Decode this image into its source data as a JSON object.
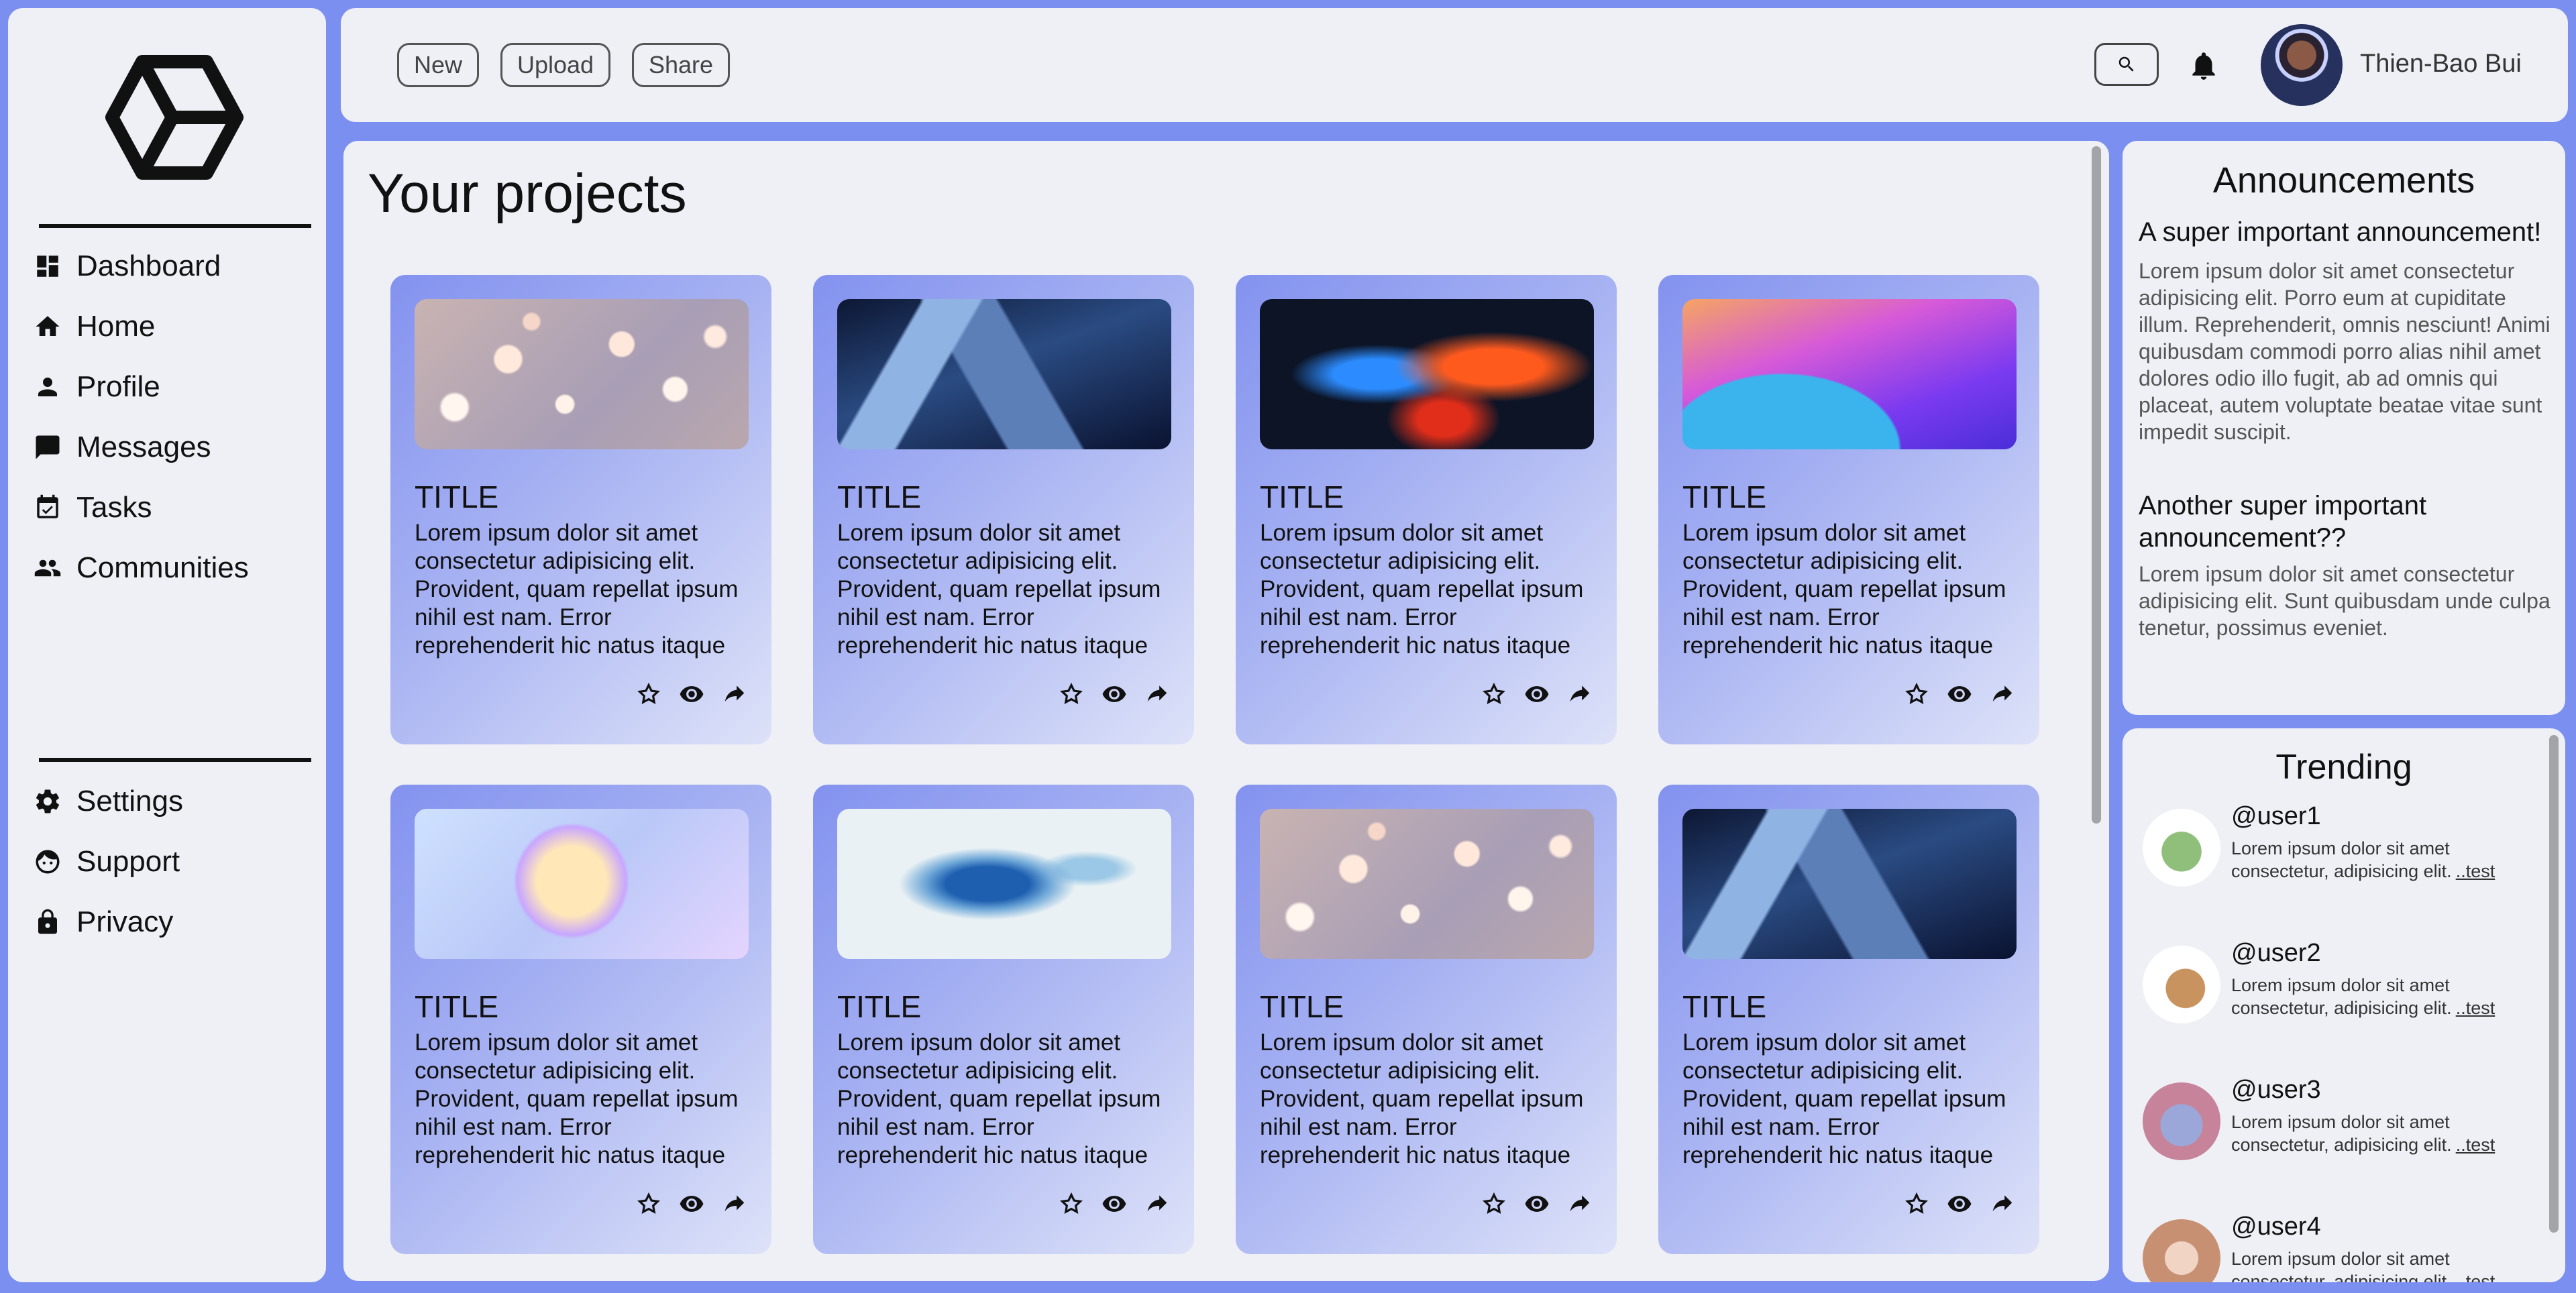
{
  "sidebar": {
    "nav_items": [
      {
        "label": "Dashboard",
        "icon": "dashboard-icon"
      },
      {
        "label": "Home",
        "icon": "home-icon"
      },
      {
        "label": "Profile",
        "icon": "person-icon"
      },
      {
        "label": "Messages",
        "icon": "message-icon"
      },
      {
        "label": "Tasks",
        "icon": "calendar-check-icon"
      },
      {
        "label": "Communities",
        "icon": "group-icon"
      }
    ],
    "bottom_items": [
      {
        "label": "Settings",
        "icon": "gear-icon"
      },
      {
        "label": "Support",
        "icon": "support-icon"
      },
      {
        "label": "Privacy",
        "icon": "lock-icon"
      }
    ]
  },
  "topbar": {
    "buttons": [
      "New",
      "Upload",
      "Share"
    ],
    "username": "Thien-Bao Bui"
  },
  "main": {
    "title": "Your projects",
    "cards": [
      {
        "title": "TITLE",
        "text": "Lorem ipsum dolor sit amet consectetur adipisicing elit. Provident, quam repellat ipsum nihil est nam. Error reprehenderit hic natus itaque",
        "image": "bokeh"
      },
      {
        "title": "TITLE",
        "text": "Lorem ipsum dolor sit amet consectetur adipisicing elit. Provident, quam repellat ipsum nihil est nam. Error reprehenderit hic natus itaque",
        "image": "glass"
      },
      {
        "title": "TITLE",
        "text": "Lorem ipsum dolor sit amet consectetur adipisicing elit. Provident, quam repellat ipsum nihil est nam. Error reprehenderit hic natus itaque",
        "image": "smoke"
      },
      {
        "title": "TITLE",
        "text": "Lorem ipsum dolor sit amet consectetur adipisicing elit. Provident, quam repellat ipsum nihil est nam. Error reprehenderit hic natus itaque",
        "image": "waves"
      },
      {
        "title": "TITLE",
        "text": "Lorem ipsum dolor sit amet consectetur adipisicing elit. Provident, quam repellat ipsum nihil est nam. Error reprehenderit hic natus itaque",
        "image": "sphere"
      },
      {
        "title": "TITLE",
        "text": "Lorem ipsum dolor sit amet consectetur adipisicing elit. Provident, quam repellat ipsum nihil est nam. Error reprehenderit hic natus itaque",
        "image": "ink"
      },
      {
        "title": "TITLE",
        "text": "Lorem ipsum dolor sit amet consectetur adipisicing elit. Provident, quam repellat ipsum nihil est nam. Error reprehenderit hic natus itaque",
        "image": "bokeh"
      },
      {
        "title": "TITLE",
        "text": "Lorem ipsum dolor sit amet consectetur adipisicing elit. Provident, quam repellat ipsum nihil est nam. Error reprehenderit hic natus itaque",
        "image": "glass"
      }
    ]
  },
  "announcements": {
    "title": "Announcements",
    "items": [
      {
        "heading": "A super important announcement!",
        "body": "Lorem ipsum dolor sit amet consectetur adipisicing elit. Porro eum at cupiditate illum. Reprehenderit, omnis nesciunt! Animi quibusdam commodi porro alias nihil amet dolores odio illo fugit, ab ad omnis qui placeat, autem voluptate beatae vitae sunt impedit suscipit."
      },
      {
        "heading": "Another super important announcement??",
        "body": "Lorem ipsum dolor sit amet consectetur adipisicing elit. Sunt quibusdam unde culpa tenetur, possimus eveniet."
      }
    ]
  },
  "trending": {
    "title": "Trending",
    "users": [
      {
        "handle": "@user1",
        "text": "Lorem ipsum dolor sit amet consectetur, adipisicing elit.",
        "link": "..test"
      },
      {
        "handle": "@user2",
        "text": "Lorem ipsum dolor sit amet consectetur, adipisicing elit.",
        "link": "..test"
      },
      {
        "handle": "@user3",
        "text": "Lorem ipsum dolor sit amet consectetur, adipisicing elit.",
        "link": "..test"
      },
      {
        "handle": "@user4",
        "text": "Lorem ipsum dolor sit amet consectetur, adipisicing elit.",
        "link": "..test"
      }
    ]
  },
  "colors": {
    "background": "#7b8ff0",
    "panel": "#eef0f5",
    "card_gradient_start": "#8392ef",
    "card_gradient_end": "#dde2f8"
  }
}
